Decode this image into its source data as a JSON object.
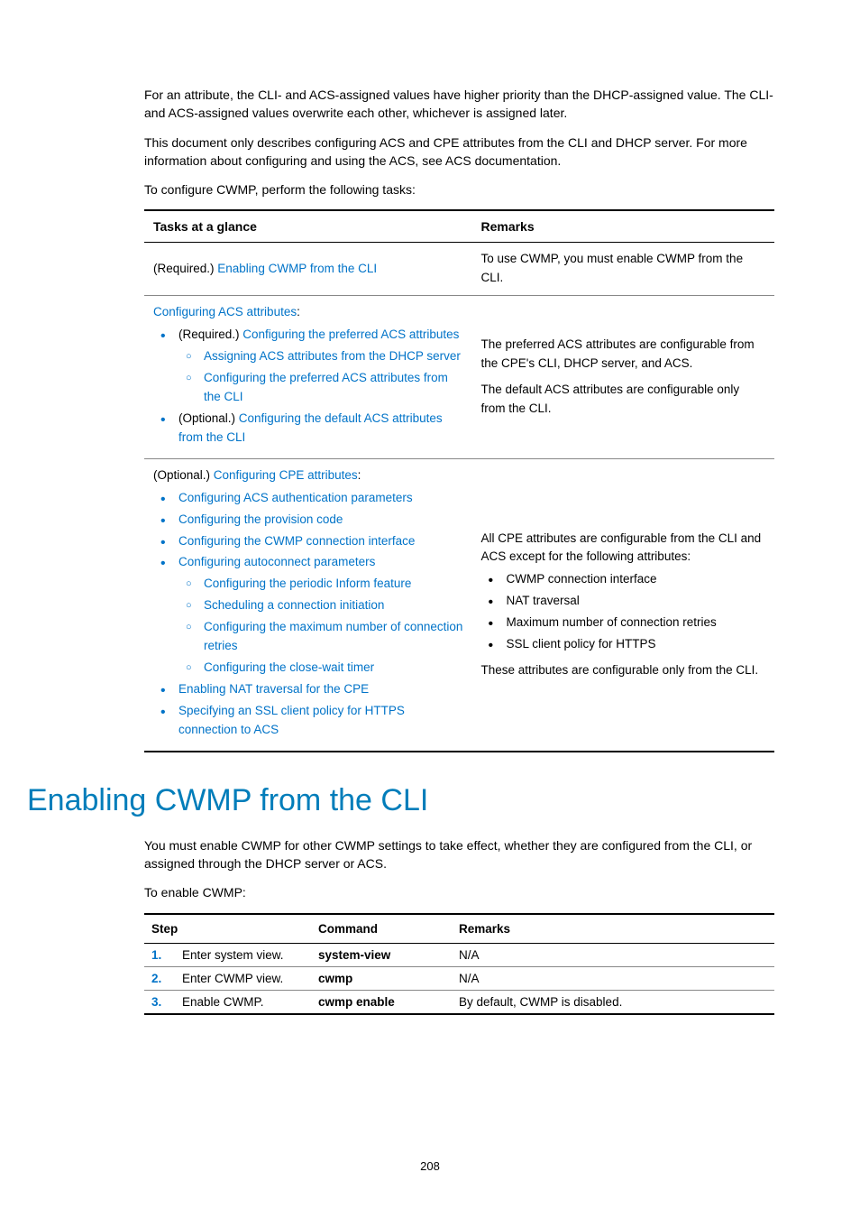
{
  "intro": {
    "p1": "For an attribute, the CLI- and ACS-assigned values have higher priority than the DHCP-assigned value. The CLI- and ACS-assigned values overwrite each other, whichever is assigned later.",
    "p2": "This document only describes configuring ACS and CPE attributes from the CLI and DHCP server. For more information about configuring and using the ACS, see ACS documentation.",
    "p3": "To configure CWMP, perform the following tasks:"
  },
  "task_table": {
    "headers": {
      "tasks": "Tasks at a glance",
      "remarks": "Remarks"
    },
    "row1": {
      "prefix": "(Required.) ",
      "link": "Enabling CWMP from the CLI",
      "remark": "To use CWMP, you must enable CWMP from the CLI."
    },
    "row2": {
      "top_link": "Configuring ACS attributes",
      "req_prefix": "(Required.) ",
      "req_link": "Configuring the preferred ACS attributes",
      "sub1": "Assigning ACS attributes from the DHCP server",
      "sub2": "Configuring the preferred ACS attributes from the CLI",
      "opt_prefix": "(Optional.) ",
      "opt_link": "Configuring the default ACS attributes from the CLI",
      "remark_p1": "The preferred ACS attributes are configurable from the CPE's CLI, DHCP server, and ACS.",
      "remark_p2": "The default ACS attributes are configurable only from the CLI."
    },
    "row3": {
      "prefix": "(Optional.) ",
      "top_link": "Configuring CPE attributes",
      "li1": "Configuring ACS authentication parameters",
      "li2": "Configuring the provision code",
      "li3": "Configuring the CWMP connection interface",
      "li4": "Configuring autoconnect parameters",
      "sub1": "Configuring the periodic Inform feature",
      "sub2": "Scheduling a connection initiation",
      "sub3": "Configuring the maximum number of connection retries",
      "sub4": "Configuring the close-wait timer",
      "li5": "Enabling NAT traversal for the CPE",
      "li6": "Specifying an SSL client policy for HTTPS connection to ACS",
      "remark_p1": "All CPE attributes are configurable from the CLI and ACS except for the following attributes:",
      "remark_b1": "CWMP connection interface",
      "remark_b2": "NAT traversal",
      "remark_b3": "Maximum number of connection retries",
      "remark_b4": "SSL client policy for HTTPS",
      "remark_p2": "These attributes are configurable only from the CLI."
    }
  },
  "section": {
    "heading": "Enabling CWMP from the CLI",
    "p1": "You must enable CWMP for other CWMP settings to take effect, whether they are configured from the CLI, or assigned through the DHCP server or ACS.",
    "p2": "To enable CWMP:"
  },
  "step_table": {
    "headers": {
      "step": "Step",
      "command": "Command",
      "remarks": "Remarks"
    },
    "rows": [
      {
        "n": "1.",
        "desc": "Enter system view.",
        "cmd": "system-view",
        "rem": "N/A"
      },
      {
        "n": "2.",
        "desc": "Enter CWMP view.",
        "cmd": "cwmp",
        "rem": "N/A"
      },
      {
        "n": "3.",
        "desc": "Enable CWMP.",
        "cmd": "cwmp enable",
        "rem": "By default, CWMP is disabled."
      }
    ]
  },
  "page_number": "208"
}
